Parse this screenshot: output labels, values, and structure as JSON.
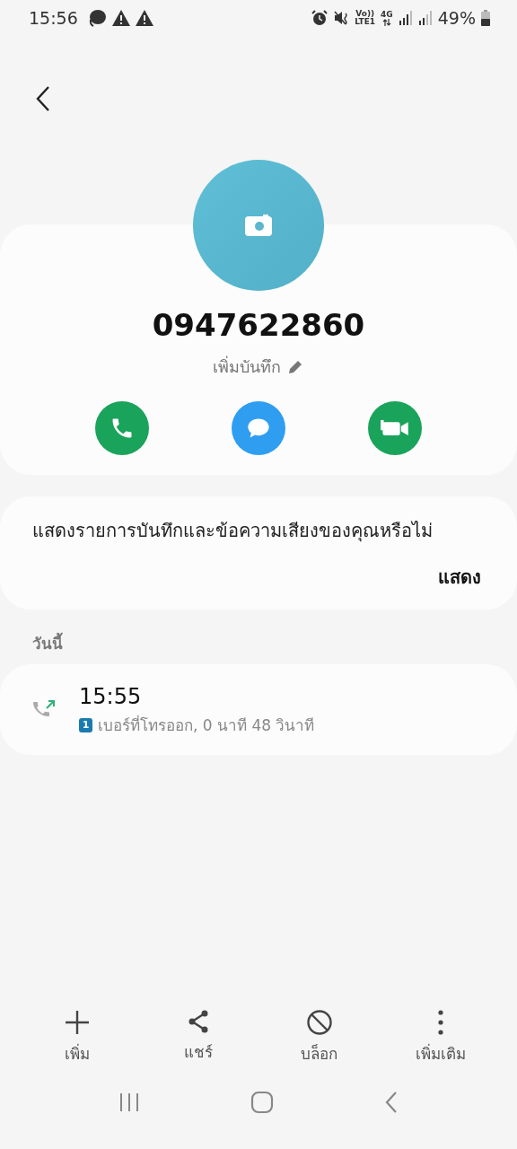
{
  "status_bar": {
    "time": "15:56",
    "volte": "Vo))",
    "lte": "LTE1",
    "network": "4G",
    "battery": "49%"
  },
  "contact": {
    "number": "0947622860",
    "note_link": "เพิ่มบันทึก"
  },
  "actions": [
    {
      "kind": "call"
    },
    {
      "kind": "message"
    },
    {
      "kind": "video"
    }
  ],
  "prompt": {
    "text": "แสดงรายการบันทึกและข้อความเสียงของคุณหรือไม่",
    "button": "แสดง"
  },
  "history": {
    "heading": "วันนี้",
    "entries": [
      {
        "time": "15:55",
        "sim": "1",
        "detail": "เบอร์ที่โทรออก, 0 นาที 48 วินาที"
      }
    ]
  },
  "toolbar": [
    {
      "kind": "add",
      "label": "เพิ่ม"
    },
    {
      "kind": "share",
      "label": "แชร์"
    },
    {
      "kind": "block",
      "label": "บล็อก"
    },
    {
      "kind": "more",
      "label": "เพิ่มเติม"
    }
  ]
}
